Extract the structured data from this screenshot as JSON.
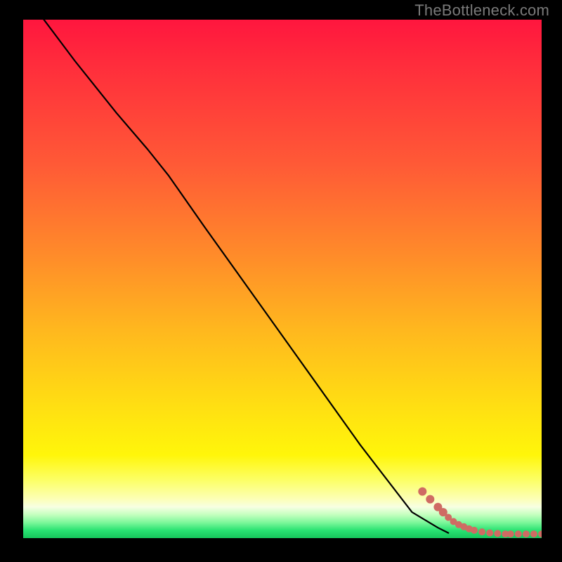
{
  "watermark": "TheBottleneck.com",
  "chart_data": {
    "type": "line",
    "title": "",
    "xlabel": "",
    "ylabel": "",
    "xlim": [
      0,
      100
    ],
    "ylim": [
      0,
      100
    ],
    "grid": false,
    "legend": false,
    "series": [
      {
        "name": "curve",
        "type": "line",
        "color": "#000000",
        "x": [
          4,
          10,
          18,
          24,
          28,
          35,
          45,
          55,
          65,
          75,
          80,
          82
        ],
        "y": [
          100,
          92,
          82,
          75,
          70,
          60,
          46,
          32,
          18,
          5,
          2,
          1
        ]
      },
      {
        "name": "markers",
        "type": "scatter",
        "color": "#cf6b63",
        "x": [
          77,
          78.5,
          80,
          81,
          82,
          83,
          84,
          85,
          86,
          87,
          88.5,
          90,
          91.5,
          93,
          94,
          95.5,
          97,
          98.5,
          100
        ],
        "y": [
          9,
          7.5,
          6,
          5,
          4,
          3.2,
          2.6,
          2.2,
          1.8,
          1.5,
          1.2,
          1.0,
          0.9,
          0.8,
          0.8,
          0.8,
          0.8,
          0.8,
          0.8
        ]
      }
    ],
    "background_gradient": {
      "orientation": "vertical",
      "stops": [
        {
          "pos": 0.0,
          "color": "#ff163e"
        },
        {
          "pos": 0.45,
          "color": "#ff8a2a"
        },
        {
          "pos": 0.75,
          "color": "#ffe012"
        },
        {
          "pos": 0.93,
          "color": "#fcffb8"
        },
        {
          "pos": 0.97,
          "color": "#7cf79a"
        },
        {
          "pos": 1.0,
          "color": "#16c65c"
        }
      ]
    }
  }
}
